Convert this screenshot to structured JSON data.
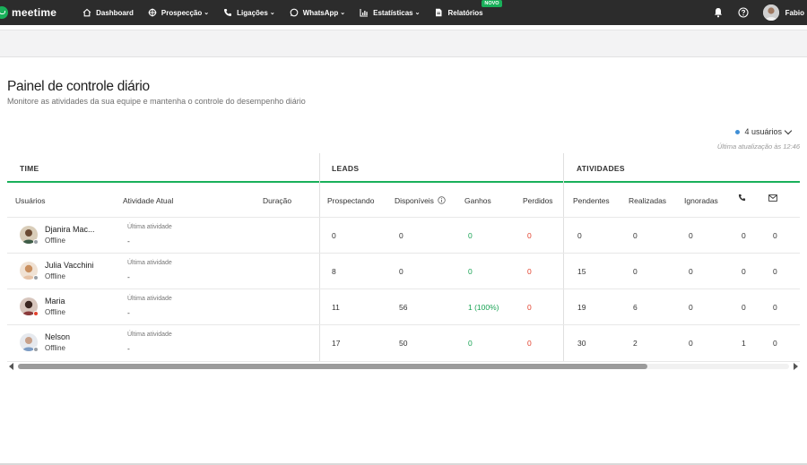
{
  "app": {
    "brand": "meetime"
  },
  "nav": [
    {
      "label": "Dashboard",
      "icon": "home-icon",
      "chevron": ""
    },
    {
      "label": "Prospecção",
      "icon": "target-icon",
      "chevron": "⌄"
    },
    {
      "label": "Ligações",
      "icon": "phone-icon",
      "chevron": "⌄"
    },
    {
      "label": "WhatsApp",
      "icon": "whatsapp-icon",
      "chevron": "⌄"
    },
    {
      "label": "Estatísticas",
      "icon": "chart-icon",
      "chevron": "⌄"
    },
    {
      "label": "Relatórios",
      "icon": "report-icon",
      "chevron": "",
      "badge": "NOVO"
    }
  ],
  "user": {
    "name": "Fabio"
  },
  "page": {
    "title": "Painel de controle diário",
    "subtitle": "Monitore as atividades da sua equipe e mantenha o controle do desempenho diário",
    "users_selector": "4 usuários",
    "last_update": "Última atualização às 12:46"
  },
  "table": {
    "groups": {
      "time": "TIME",
      "leads": "LEADS",
      "activities": "ATIVIDADES"
    },
    "headers": {
      "users": "Usuários",
      "current_activity": "Atividade Atual",
      "duration": "Duração",
      "prospecting": "Prospectando",
      "available": "Disponíveis",
      "won": "Ganhos",
      "lost": "Perdidos",
      "pending": "Pendentes",
      "done": "Realizadas",
      "ignored": "Ignoradas"
    },
    "rows": [
      {
        "name": "Djanira Mac...",
        "status": "Offline",
        "activity_label": "Última atividade",
        "activity": "-",
        "prospecting": "0",
        "available": "0",
        "won": "0",
        "lost": "0",
        "pending": "0",
        "done": "0",
        "ignored": "0",
        "calls": "0",
        "emails": "0",
        "status_color": "#9aa0a6"
      },
      {
        "name": "Julia Vacchini",
        "status": "Offline",
        "activity_label": "Última atividade",
        "activity": "-",
        "prospecting": "8",
        "available": "0",
        "won": "0",
        "lost": "0",
        "pending": "15",
        "done": "0",
        "ignored": "0",
        "calls": "0",
        "emails": "0",
        "status_color": "#9aa0a6"
      },
      {
        "name": "Maria",
        "status": "Offline",
        "activity_label": "Última atividade",
        "activity": "-",
        "prospecting": "11",
        "available": "56",
        "won": "1 (100%)",
        "lost": "0",
        "pending": "19",
        "done": "6",
        "ignored": "0",
        "calls": "0",
        "emails": "0",
        "status_color": "#e2402c"
      },
      {
        "name": "Nelson",
        "status": "Offline",
        "activity_label": "Última atividade",
        "activity": "-",
        "prospecting": "17",
        "available": "50",
        "won": "0",
        "lost": "0",
        "pending": "30",
        "done": "2",
        "ignored": "0",
        "calls": "1",
        "emails": "0",
        "status_color": "#9aa0a6"
      }
    ]
  },
  "colors": {
    "accent": "#19b05a",
    "topbar": "#2c2c2c",
    "won": "#19a354",
    "lost": "#e2402c",
    "selector_dot": "#3f8fd6"
  }
}
